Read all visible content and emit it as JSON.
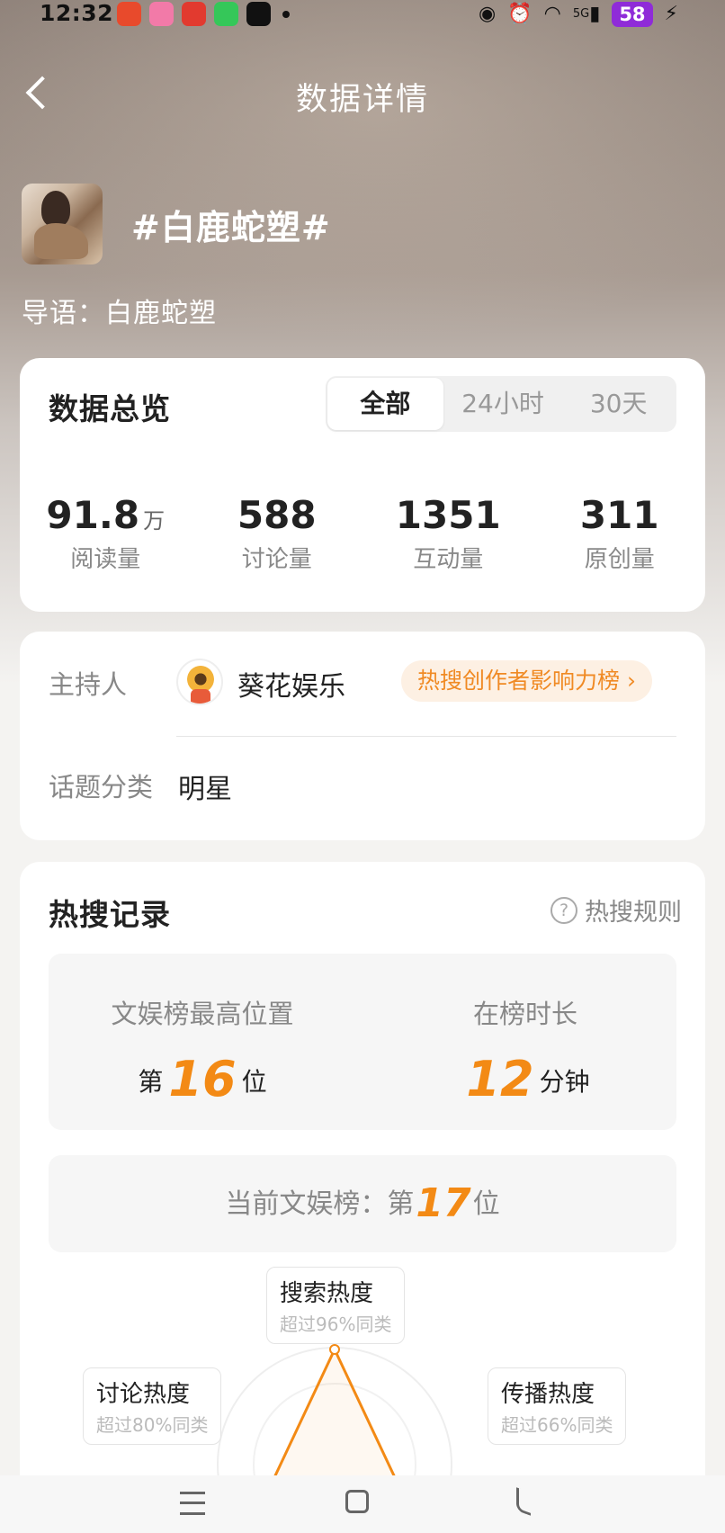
{
  "status_bar": {
    "time": "12:32",
    "battery": "58",
    "network": "5G"
  },
  "nav": {
    "title": "数据详情"
  },
  "topic": {
    "name": "#白鹿蛇塑#",
    "intro": "导语：白鹿蛇塑"
  },
  "overview": {
    "title": "数据总览",
    "tabs": [
      "全部",
      "24小时",
      "30天"
    ],
    "active_tab": "全部",
    "stats": [
      {
        "value": "91.8",
        "unit": "万",
        "label": "阅读量"
      },
      {
        "value": "588",
        "unit": "",
        "label": "讨论量"
      },
      {
        "value": "1351",
        "unit": "",
        "label": "互动量"
      },
      {
        "value": "311",
        "unit": "",
        "label": "原创量"
      }
    ]
  },
  "host": {
    "label": "主持人",
    "name": "葵花娱乐",
    "link": "热搜创作者影响力榜 ›",
    "category_label": "话题分类",
    "category": "明星"
  },
  "hot_search": {
    "title": "热搜记录",
    "rules": "热搜规则",
    "peak_title": "文娱榜最高位置",
    "peak_prefix": "第",
    "peak_value": "16",
    "peak_suffix": "位",
    "duration_title": "在榜时长",
    "duration_value": "12",
    "duration_unit": "分钟",
    "current_prefix": "当前文娱榜：第",
    "current_value": "17",
    "current_suffix": "位",
    "radar": [
      {
        "title": "搜索热度",
        "sub": "超过96%同类"
      },
      {
        "title": "讨论热度",
        "sub": "超过80%同类"
      },
      {
        "title": "传播热度",
        "sub": "超过66%同类"
      }
    ]
  },
  "colors": {
    "accent": "#f38a15",
    "battery": "#8f2bd8"
  }
}
